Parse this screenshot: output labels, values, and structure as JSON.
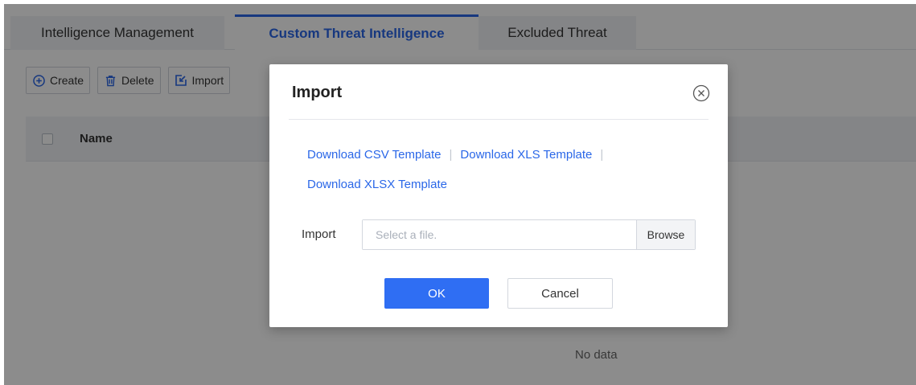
{
  "tabs": [
    {
      "label": "Intelligence Management",
      "active": false
    },
    {
      "label": "Custom Threat Intelligence",
      "active": true
    },
    {
      "label": "Excluded Threat",
      "active": false
    }
  ],
  "toolbar": {
    "create_label": "Create",
    "delete_label": "Delete",
    "import_label": "Import"
  },
  "table": {
    "columns": [
      "Name"
    ],
    "empty_text": "No data"
  },
  "dialog": {
    "title": "Import",
    "links": {
      "csv": "Download CSV Template",
      "xls": "Download XLS Template",
      "xlsx": "Download XLSX Template"
    },
    "import_label": "Import",
    "file_placeholder": "Select a file.",
    "browse_label": "Browse",
    "ok_label": "OK",
    "cancel_label": "Cancel"
  },
  "colors": {
    "accent": "#2a67e8",
    "primary_button": "#2f6ef3",
    "overlay": "rgba(0,0,0,0.45)"
  },
  "icons": [
    "plus-circle-icon",
    "trash-icon",
    "import-icon",
    "close-circle-icon"
  ]
}
